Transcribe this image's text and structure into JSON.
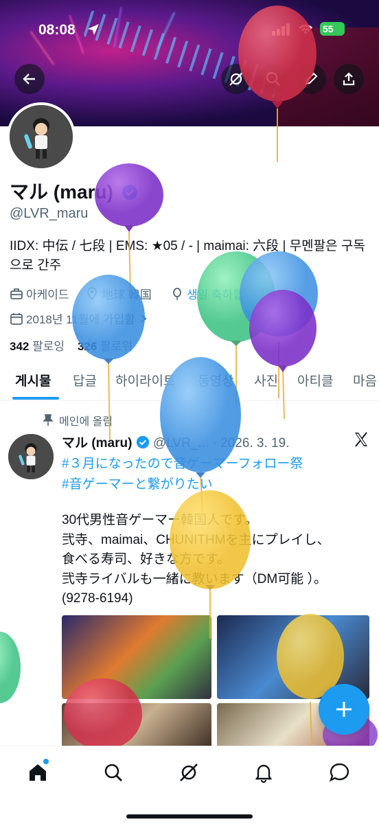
{
  "status_bar": {
    "time": "08:08",
    "battery": "55"
  },
  "profile": {
    "name": "マル (maru)",
    "handle": "@LVR_maru",
    "bio": "IIDX: 中伝 / 七段 | EMS: ★05 / - | maimai: 六段 | 무멘팔은 구독으로 간주",
    "category": "아케이드",
    "location": "地球 韓国",
    "birthday": "생일 축하합니다",
    "joined": "2018년 11월에 가입함",
    "following_count": "342",
    "following_label": "팔로잉",
    "followers_count": "326",
    "followers_label": "팔로워"
  },
  "tabs": [
    "게시물",
    "답글",
    "하이라이트",
    "동영상",
    "사진",
    "아티클",
    "마음"
  ],
  "post": {
    "pinned_label": "메인에 올림",
    "author": "マル (maru)",
    "handle": "@LVR_...",
    "separator": "·",
    "date": "2026. 3. 19.",
    "hashtags": [
      "#３月になったので音ゲーマーフォロー祭",
      "#音ゲーマーと繋がりたい"
    ],
    "body": "30代男性音ゲーマー韓国人です。\n弐寺、maimai、CHUNITHMを主にプレイし、\n食べる寿司、好きな方です。\n弐寺ライバルも一緒に教います（DM可能 ）。\n(9278-6194)"
  },
  "icons": {
    "back": "arrow-left-icon",
    "grok": "grok-icon",
    "search": "search-icon",
    "edit": "pencil-icon",
    "share": "share-icon",
    "verified": "verified-badge-icon",
    "x_logo": "x-logo-icon",
    "compose": "plus-icon",
    "nav": [
      "home-icon",
      "search-icon",
      "grok-icon",
      "bell-icon",
      "message-icon"
    ]
  },
  "colors": {
    "accent": "#1d9bf0",
    "text": "#0f1419",
    "muted": "#536471"
  }
}
